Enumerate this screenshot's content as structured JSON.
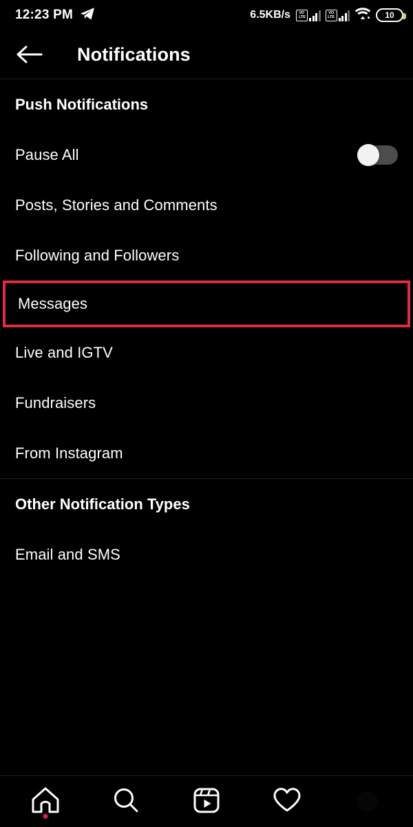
{
  "status_bar": {
    "time": "12:23 PM",
    "app_icon": "telegram-icon",
    "network_speed": "6.5KB/s",
    "sim1_label": "VoLTE",
    "sim1_top": "VO",
    "sim1_bottom": "LTE",
    "sim2_top": "VO",
    "sim2_bottom": "LTE",
    "wifi_icon": "wifi-icon",
    "battery_level": "10"
  },
  "app_bar": {
    "back_icon": "back-arrow-icon",
    "title": "Notifications"
  },
  "sections": [
    {
      "title": "Push Notifications",
      "rows": [
        {
          "label": "Pause All",
          "control": "toggle",
          "toggle_on": false,
          "highlighted": false
        },
        {
          "label": "Posts, Stories and Comments",
          "control": "none",
          "highlighted": false
        },
        {
          "label": "Following and Followers",
          "control": "none",
          "highlighted": false
        },
        {
          "label": "Messages",
          "control": "none",
          "highlighted": true
        },
        {
          "label": "Live and IGTV",
          "control": "none",
          "highlighted": false
        },
        {
          "label": "Fundraisers",
          "control": "none",
          "highlighted": false
        },
        {
          "label": "From Instagram",
          "control": "none",
          "highlighted": false
        }
      ]
    },
    {
      "title": "Other Notification Types",
      "rows": [
        {
          "label": "Email and SMS",
          "control": "none",
          "highlighted": false
        }
      ]
    }
  ],
  "highlight": {
    "color": "#e02b40"
  },
  "bottom_nav": [
    {
      "icon": "home-icon",
      "badge_dot": true
    },
    {
      "icon": "search-icon",
      "badge_dot": false
    },
    {
      "icon": "reels-icon",
      "badge_dot": false
    },
    {
      "icon": "heart-icon",
      "badge_dot": false
    },
    {
      "icon": "profile-avatar-icon",
      "badge_dot": false
    }
  ]
}
